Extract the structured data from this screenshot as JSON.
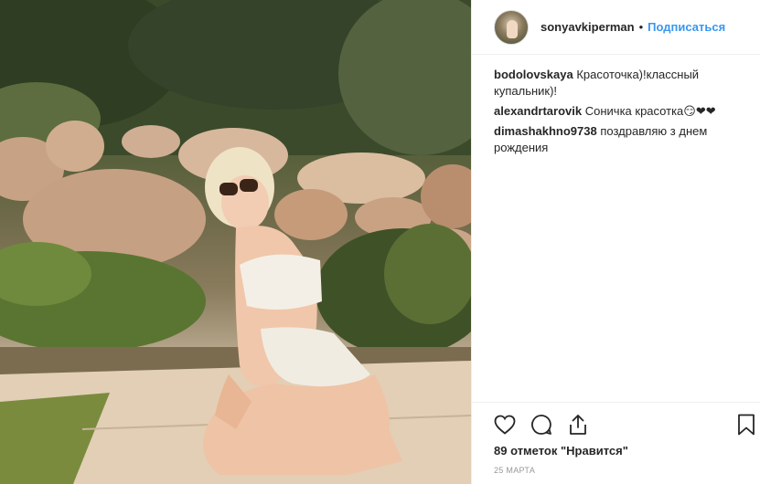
{
  "post": {
    "username": "sonyavkiperman",
    "separator": "•",
    "follow_label": "Подписаться",
    "likes_text": "89 отметок \"Нравится\"",
    "date": "25 МАРТА"
  },
  "comments": [
    {
      "user": "bodolovskaya",
      "text": "Красоточка)!классный купальник)!"
    },
    {
      "user": "alexandrtarovik",
      "text": "Соничка красотка😏❤❤"
    },
    {
      "user": "dimashakhno9738",
      "text": "поздравляю з днем рождения"
    }
  ],
  "icons": {
    "like": "heart-icon",
    "comment": "comment-bubble-icon",
    "share": "share-icon",
    "save": "bookmark-icon"
  },
  "colors": {
    "accent": "#3897f0",
    "text": "#262626",
    "muted": "#999999",
    "border": "#efefef"
  }
}
